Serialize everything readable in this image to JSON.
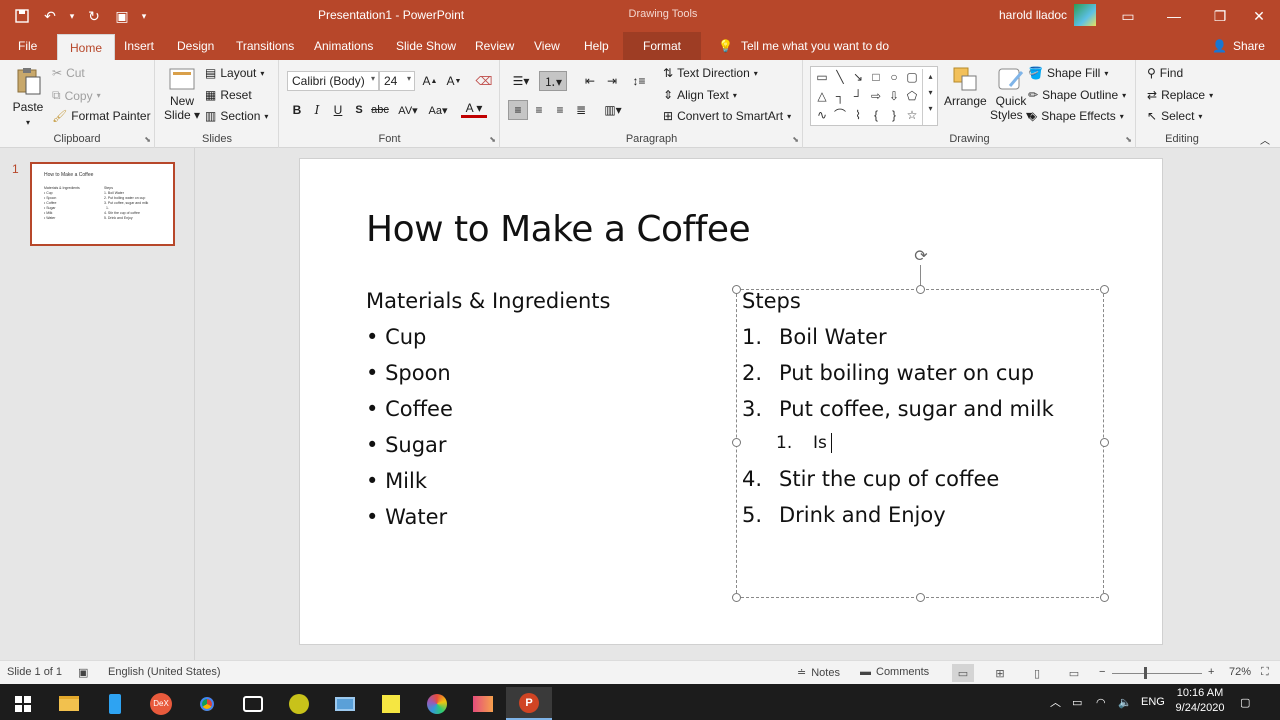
{
  "app": {
    "document_title": "Presentation1  -  PowerPoint",
    "context_title": "Drawing Tools",
    "user_name": "harold lladoc"
  },
  "tabs": [
    {
      "label": "File"
    },
    {
      "label": "Home"
    },
    {
      "label": "Insert"
    },
    {
      "label": "Design"
    },
    {
      "label": "Transitions"
    },
    {
      "label": "Animations"
    },
    {
      "label": "Slide Show"
    },
    {
      "label": "Review"
    },
    {
      "label": "View"
    },
    {
      "label": "Help"
    },
    {
      "label": "Format"
    }
  ],
  "tell_me": "Tell me what you want to do",
  "share": "Share",
  "ribbon": {
    "clipboard": {
      "label": "Clipboard",
      "paste": "Paste",
      "cut": "Cut",
      "copy": "Copy",
      "format_painter": "Format Painter"
    },
    "slides": {
      "label": "Slides",
      "new_slide": "New",
      "new_slide2": "Slide",
      "layout": "Layout",
      "reset": "Reset",
      "section": "Section"
    },
    "font": {
      "label": "Font",
      "family": "Calibri (Body)",
      "size": "24"
    },
    "paragraph": {
      "label": "Paragraph",
      "text_direction": "Text Direction",
      "align_text": "Align Text",
      "convert_smartart": "Convert to SmartArt"
    },
    "drawing": {
      "label": "Drawing",
      "arrange": "Arrange",
      "quick_styles": "Quick",
      "quick_styles2": "Styles",
      "shape_fill": "Shape Fill",
      "shape_outline": "Shape Outline",
      "shape_effects": "Shape Effects"
    },
    "editing": {
      "label": "Editing",
      "find": "Find",
      "replace": "Replace",
      "select": "Select"
    }
  },
  "thumbnail": {
    "number": "1"
  },
  "slide": {
    "title": "How to Make a Coffee",
    "left_heading": "Materials & Ingredients",
    "left_items": [
      "Cup",
      "Spoon",
      "Coffee",
      "Sugar",
      "Milk",
      "Water"
    ],
    "right_heading": "Steps",
    "steps": [
      {
        "num": "1.",
        "text": "Boil Water"
      },
      {
        "num": "2.",
        "text": "Put boiling water on cup"
      },
      {
        "num": "3.",
        "text": "Put coffee, sugar and milk"
      }
    ],
    "substep": {
      "num": "1.",
      "text": "Is"
    },
    "steps_after": [
      {
        "num": "4.",
        "text": "Stir the cup of coffee"
      },
      {
        "num": "5.",
        "text": "Drink and Enjoy"
      }
    ]
  },
  "status": {
    "slide_info": "Slide 1 of 1",
    "language": "English (United States)",
    "notes": "Notes",
    "comments": "Comments",
    "zoom": "72%"
  },
  "taskbar": {
    "lang": "ENG",
    "time": "10:16 AM",
    "date": "9/24/2020"
  },
  "colors": {
    "accent": "#b7472a",
    "ribbon_bg": "#f3f3f3"
  }
}
